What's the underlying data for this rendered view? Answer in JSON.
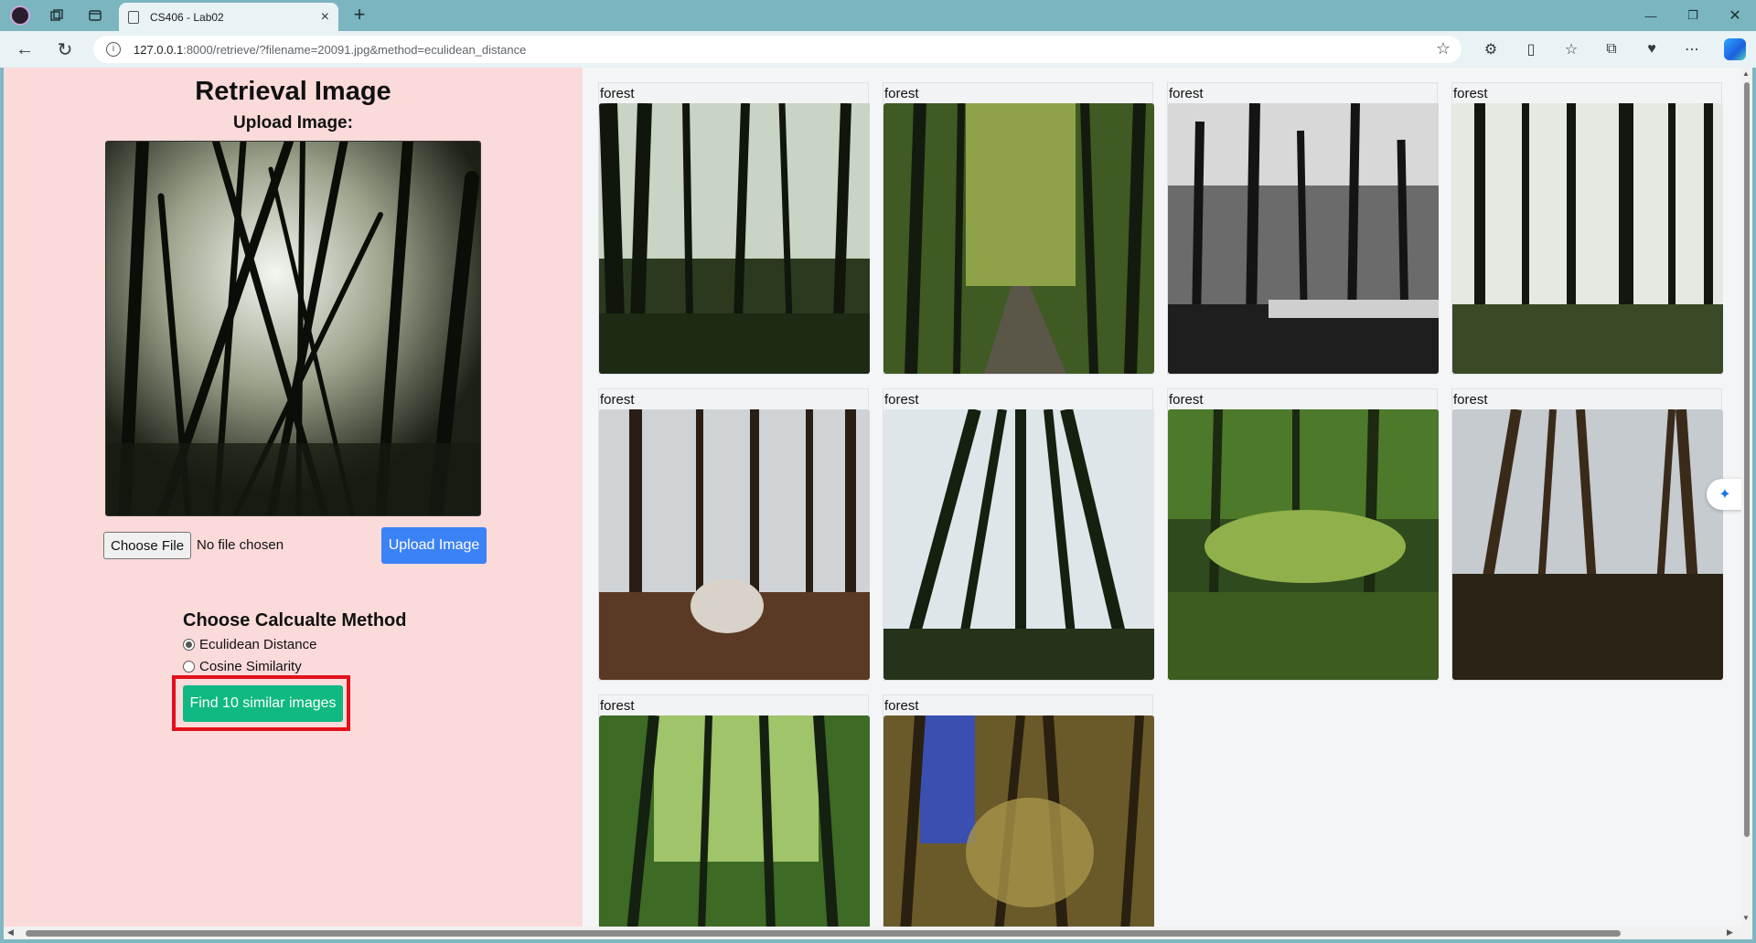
{
  "browser": {
    "tab_title": "CS406 - Lab02",
    "url_host": "127.0.0.1",
    "url_rest": ":8000/retrieve/?filename=20091.jpg&method=eculidean_distance",
    "new_tab": "+",
    "close_tab": "×"
  },
  "page": {
    "title": "Retrieval Image",
    "upload_label": "Upload Image:",
    "choose_file_label": "Choose File",
    "no_file_text": "No file chosen",
    "upload_button": "Upload Image",
    "method_title": "Choose Calcualte Method",
    "methods": [
      {
        "label": "Eculidean Distance",
        "checked": true
      },
      {
        "label": "Cosine Similarity",
        "checked": false
      }
    ],
    "find_button": "Find 10 similar images"
  },
  "results": [
    {
      "label": "forest"
    },
    {
      "label": "forest"
    },
    {
      "label": "forest"
    },
    {
      "label": "forest"
    },
    {
      "label": "forest"
    },
    {
      "label": "forest"
    },
    {
      "label": "forest"
    },
    {
      "label": "forest"
    },
    {
      "label": "forest"
    },
    {
      "label": "forest"
    }
  ],
  "colors": {
    "chrome": "#7ab5c0",
    "left_panel": "#fbdada",
    "upload_button": "#3b82f6",
    "find_button": "#10b981",
    "highlight": "#e3101a"
  }
}
